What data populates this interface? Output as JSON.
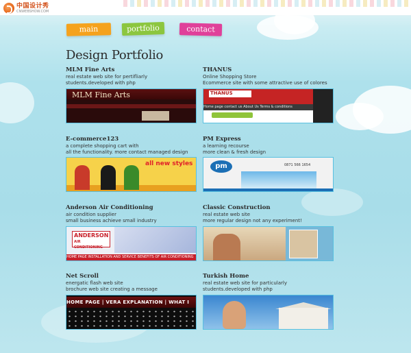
{
  "header": {
    "logo_cn": "中国设计秀",
    "logo_en": "CNWEBSHOW.COM"
  },
  "nav": {
    "main": "main",
    "portfolio": "portfolio",
    "contact": "contact"
  },
  "page_title": "Design Portfolio",
  "projects": [
    {
      "name": "MLM Fine Arts",
      "desc": [
        "real estate web site for pertifliarly",
        "students.developed with php"
      ],
      "thumb": {
        "logo": "MLM Fine Arts"
      }
    },
    {
      "name": "THANUS",
      "desc": [
        "Online Shopping Store",
        "Ecommerce site with some attractive use of colores"
      ],
      "thumb": {
        "logo": "THANUS",
        "nav": "Home page   contact us   About Us   Terms & conditions"
      }
    },
    {
      "name": "E-commerce123",
      "desc": [
        "a complete shopping cart with",
        "all the functionality. more contact managed design"
      ],
      "thumb": {
        "tag": "all new styles"
      }
    },
    {
      "name": "PM Express",
      "desc": [
        "a learning recourse",
        "more clean & fresh design"
      ],
      "thumb": {
        "logo": "pm",
        "phone": "0871 566 1654"
      }
    },
    {
      "name": "Anderson Air Conditioning",
      "desc": [
        "air condition supplier",
        "small business achieve small industry"
      ],
      "thumb": {
        "line1": "ANDERSON",
        "line2": "AIR CONDITIONING",
        "nav": "HOME PAGE   INSTALLATION AND SERVICE   BENEFITS OF AIR CONDITIONING"
      }
    },
    {
      "name": "Classic Construction",
      "desc": [
        "real estate web site",
        "more regular design not any experiment!"
      ],
      "thumb": {}
    },
    {
      "name": "Net Scroll",
      "desc": [
        "energatic flash web site",
        "brochure web site creating a message"
      ],
      "thumb": {
        "nav": "HOME PAGE  |  VERA EXPLANATION  |  WHAT I"
      }
    },
    {
      "name": "Turkish Home",
      "desc": [
        "real estate web site for particularly",
        "students.developed with php"
      ],
      "thumb": {}
    }
  ]
}
